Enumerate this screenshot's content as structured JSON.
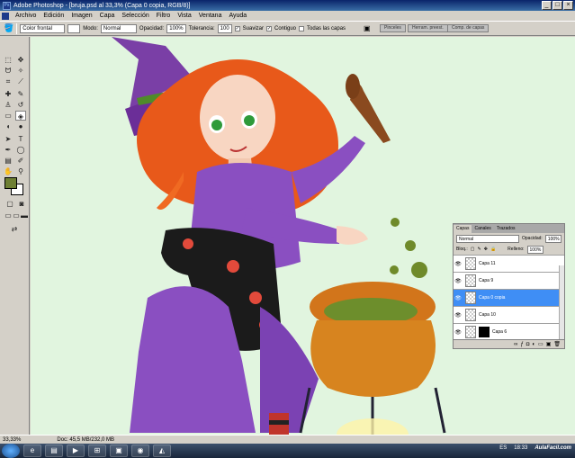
{
  "window": {
    "title": "Adobe Photoshop - [bruja.psd al 33,3% (Capa 0 copia, RGB/8)]"
  },
  "menu": [
    "Archivo",
    "Edición",
    "Imagen",
    "Capa",
    "Selección",
    "Filtro",
    "Vista",
    "Ventana",
    "Ayuda"
  ],
  "options": {
    "preset": "Color frontal",
    "mode_label": "Modo:",
    "mode_value": "Normal",
    "opacity_label": "Opacidad:",
    "opacity_value": "100%",
    "tolerance_label": "Tolerancia:",
    "tolerance_value": "100",
    "antialias_label": "Suavizar",
    "antialias_checked": "✓",
    "contiguous_label": "Contiguo",
    "contiguous_checked": "✓",
    "alllayers_label": "Todas las capas"
  },
  "palette_well": [
    "Pinceles",
    "Herram. preest.",
    "Comp. de capas"
  ],
  "layers_panel": {
    "tabs": [
      "Capas",
      "Canales",
      "Trazados"
    ],
    "blend_mode": "Normal",
    "opacity_label": "Opacidad:",
    "opacity_value": "100%",
    "lock_label": "Bloq.:",
    "fill_label": "Relleno:",
    "fill_value": "100%",
    "layers": [
      {
        "name": "Capa 11"
      },
      {
        "name": "Capa 9"
      },
      {
        "name": "Capa 0 copia"
      },
      {
        "name": "Capa 10"
      },
      {
        "name": "Capa 6"
      }
    ]
  },
  "status": {
    "zoom": "33,33%",
    "doc": "Doc: 45,5 MB/232,0 MB"
  },
  "taskbar": {
    "lang": "ES",
    "time": "18:33",
    "watermark": "AulaFacil.com"
  },
  "colors": {
    "foreground": "#6e7f33",
    "background": "#ffffff",
    "selection": "#3f8ef5",
    "canvas": "#e1f5df"
  }
}
